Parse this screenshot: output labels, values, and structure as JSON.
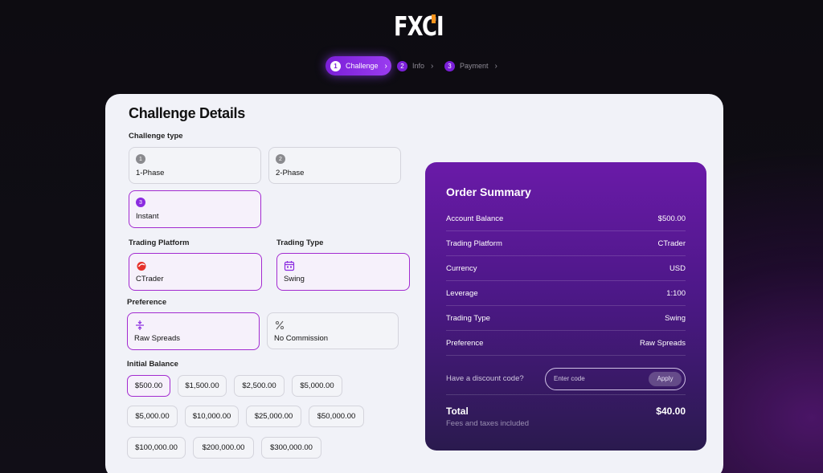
{
  "brand": {
    "logo_text": "FXCI",
    "accent": "#f7941d"
  },
  "stepper": [
    {
      "num": "1",
      "label": "Challenge",
      "active": true
    },
    {
      "num": "2",
      "label": "Info",
      "active": false
    },
    {
      "num": "3",
      "label": "Payment",
      "active": false
    }
  ],
  "title": "Challenge Details",
  "challenge_type": {
    "label": "Challenge type",
    "options": [
      {
        "num": "1",
        "label": "1-Phase",
        "selected": false
      },
      {
        "num": "2",
        "label": "2-Phase",
        "selected": false
      },
      {
        "num": "3",
        "label": "Instant",
        "selected": true
      }
    ]
  },
  "trading_platform": {
    "label": "Trading Platform",
    "value": "CTrader",
    "icon": "ctrader-icon"
  },
  "trading_type": {
    "label": "Trading Type",
    "value": "Swing",
    "icon": "calendar-icon"
  },
  "preference": {
    "label": "Preference",
    "options": [
      {
        "label": "Raw Spreads",
        "icon": "spread-icon",
        "selected": true
      },
      {
        "label": "No Commission",
        "icon": "percent-icon",
        "selected": false
      }
    ]
  },
  "initial_balance": {
    "label": "Initial Balance",
    "options": [
      "$500.00",
      "$1,500.00",
      "$2,500.00",
      "$5,000.00",
      "$5,000.00",
      "$10,000.00",
      "$25,000.00",
      "$50,000.00",
      "$100,000.00",
      "$200,000.00",
      "$300,000.00"
    ],
    "selected_index": 0
  },
  "summary": {
    "title": "Order Summary",
    "rows": [
      {
        "label": "Account Balance",
        "value": "$500.00"
      },
      {
        "label": "Trading Platform",
        "value": "CTrader"
      },
      {
        "label": "Currency",
        "value": "USD"
      },
      {
        "label": "Leverage",
        "value": "1:100"
      },
      {
        "label": "Trading Type",
        "value": "Swing"
      },
      {
        "label": "Preference",
        "value": "Raw Spreads"
      }
    ],
    "discount_question": "Have a discount code?",
    "discount_placeholder": "Enter code",
    "apply_label": "Apply",
    "total_label": "Total",
    "total_sub": "Fees and taxes included",
    "total_value": "$40.00"
  },
  "colors": {
    "accent_purple": "#8b2be0",
    "selected_border": "#a32bd0"
  }
}
